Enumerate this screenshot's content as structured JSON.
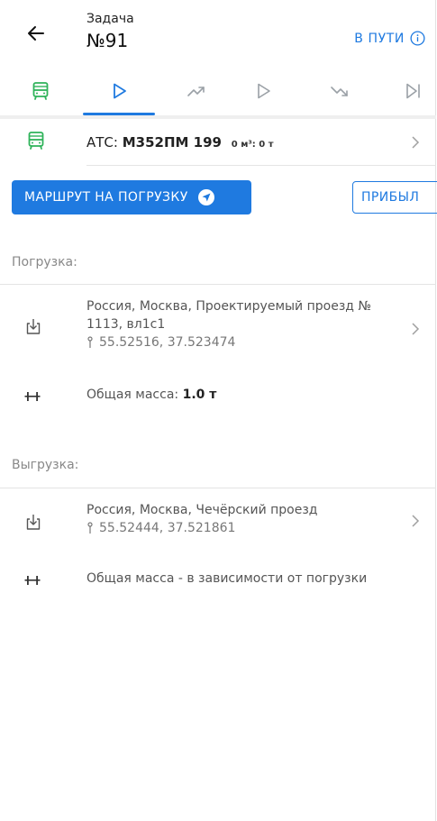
{
  "header": {
    "back_icon": "arrow-left-icon",
    "task_label": "Задача",
    "task_number": "№91",
    "status": "В ПУТИ",
    "status_icon": "info-icon"
  },
  "tabs": [
    {
      "icon": "bus-icon",
      "active": false
    },
    {
      "icon": "play-outline-icon",
      "active": true
    },
    {
      "icon": "trend-up-icon",
      "active": false
    },
    {
      "icon": "play-outline-icon",
      "active": false
    },
    {
      "icon": "trend-down-icon",
      "active": false
    },
    {
      "icon": "skip-next-icon",
      "active": false
    }
  ],
  "vehicle": {
    "prefix": "АТС:",
    "plate": "М352ПМ 199",
    "capacity_volume": "0 м³",
    "capacity_weight": "0 т"
  },
  "actions": {
    "route_button": "МАРШРУТ НА ПОГРУЗКУ",
    "arrived_button": "ПРИБЫЛ"
  },
  "loading": {
    "title": "Погрузка:",
    "address": "Россия, Москва, Проектируемый проезд № 1113, вл1с1",
    "coords": "55.52516, 37.523474",
    "mass_label": "Общая масса:",
    "mass_value": "1.0 т"
  },
  "unloading": {
    "title": "Выгрузка:",
    "address": "Россия, Москва, Чечёрский проезд",
    "coords": "55.52444, 37.521861",
    "mass_text": "Общая масса - в зависимости от погрузки"
  },
  "colors": {
    "accent": "#1f7ae0",
    "green_icon": "#2fb35a",
    "muted_icon": "#9aa0a6"
  }
}
